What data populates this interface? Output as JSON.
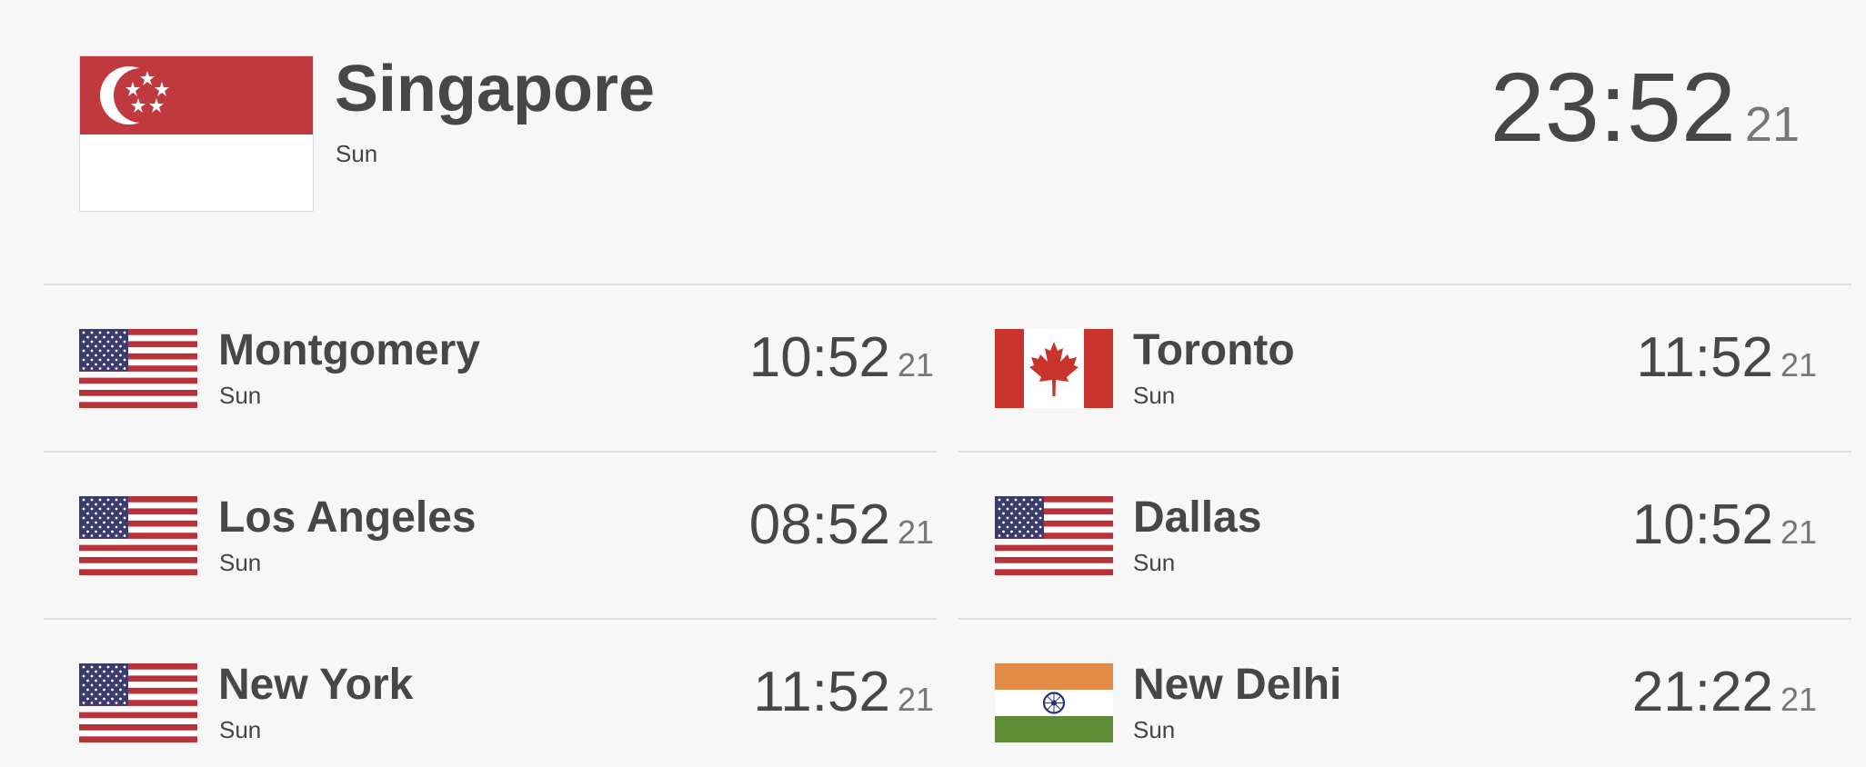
{
  "main": {
    "name": "Singapore",
    "day": "Sun",
    "time": "23:52",
    "seconds": "21",
    "flag": "singapore-flag"
  },
  "cities": [
    {
      "name": "Montgomery",
      "day": "Sun",
      "time": "10:52",
      "seconds": "21",
      "flag": "usa-flag"
    },
    {
      "name": "Toronto",
      "day": "Sun",
      "time": "11:52",
      "seconds": "21",
      "flag": "canada-flag"
    },
    {
      "name": "Los Angeles",
      "day": "Sun",
      "time": "08:52",
      "seconds": "21",
      "flag": "usa-flag"
    },
    {
      "name": "Dallas",
      "day": "Sun",
      "time": "10:52",
      "seconds": "21",
      "flag": "usa-flag"
    },
    {
      "name": "New York",
      "day": "Sun",
      "time": "11:52",
      "seconds": "21",
      "flag": "usa-flag"
    },
    {
      "name": "New Delhi",
      "day": "Sun",
      "time": "21:22",
      "seconds": "21",
      "flag": "india-flag"
    }
  ],
  "colors": {
    "background": "#f7f7f7",
    "text": "#474747",
    "seconds": "#777777",
    "divider": "#dedede"
  }
}
